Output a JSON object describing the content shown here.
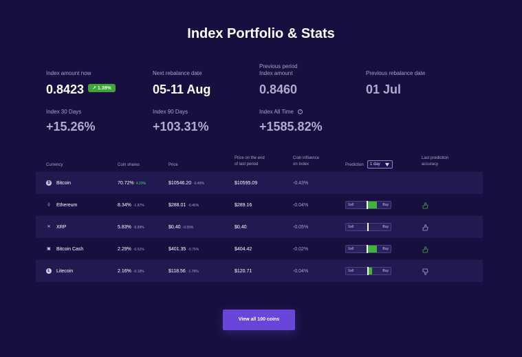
{
  "page": {
    "title": "Index Portfolio & Stats"
  },
  "stats": {
    "index_amount_now": {
      "label": "Index amount now",
      "value": "0.8423",
      "badge": "↗ 1.39%"
    },
    "next_rebalance": {
      "label": "Next rebalance date",
      "value": "05-11 Aug"
    },
    "previous_period": {
      "label_line1": "Previous period",
      "label_line2": "Index amount",
      "value": "0.8460"
    },
    "previous_rebalance": {
      "label": "Previous rebalance date",
      "value": "01 Jul"
    },
    "index_30": {
      "label": "Index 30 Days",
      "value": "+15.26%"
    },
    "index_90": {
      "label": "Index 90 Days",
      "value": "+103.31%"
    },
    "index_all": {
      "label": "Index All Time",
      "value": "+1585.82%"
    }
  },
  "table": {
    "headers": {
      "currency": "Currency",
      "coin_shares": "Coin shares",
      "price": "Price",
      "price_end_line1": "Price on the end",
      "price_end_line2": "of last period",
      "influence_line1": "Coin influence",
      "influence_line2": "on Index",
      "prediction": "Prediction",
      "prediction_select": "1 day",
      "accuracy_line1": "Last prediction",
      "accuracy_line2": "accuracy"
    },
    "rows": [
      {
        "name": "Bitcoin",
        "share": "70.72%",
        "share_change": "4.20%",
        "price": "$10546.20",
        "price_change": "-0.46%",
        "price_end": "$10595.09",
        "influence": "-0.43%",
        "has_prediction": false
      },
      {
        "name": "Ethereum",
        "share": "8.34%",
        "share_change": "-1.87%",
        "price": "$288.01",
        "price_change": "-0.46%",
        "price_end": "$289.16",
        "influence": "-0.04%",
        "has_prediction": true,
        "sell_label": "Sell",
        "buy_label": "Buy",
        "prediction_level": 0.5,
        "accuracy": "thumbs-up"
      },
      {
        "name": "XRP",
        "share": "5.83%",
        "share_change": "-5.89%",
        "price": "$0.40",
        "price_change": "-0.55%",
        "price_end": "$0.40",
        "influence": "-0.05%",
        "has_prediction": true,
        "sell_label": "Sell",
        "buy_label": "Buy",
        "prediction_level": 0.5,
        "accuracy": "thumbs-up"
      },
      {
        "name": "Bitcoin Cash",
        "share": "2.29%",
        "share_change": "-0.51%",
        "price": "$401.35",
        "price_change": "-0.75%",
        "price_end": "$404.42",
        "influence": "-0.02%",
        "has_prediction": true,
        "sell_label": "Sell",
        "buy_label": "Buy",
        "prediction_level": 0.5,
        "accuracy": "thumbs-up"
      },
      {
        "name": "Litecoin",
        "share": "2.16%",
        "share_change": "-0.19%",
        "price": "$118.56",
        "price_change": "-1.78%",
        "price_end": "$120.71",
        "influence": "-0.04%",
        "has_prediction": true,
        "sell_label": "Sell",
        "buy_label": "Buy",
        "prediction_level": 0.5,
        "accuracy": "thumbs-down"
      }
    ]
  },
  "footer": {
    "view_all_label": "View all 100 coins"
  },
  "colors": {
    "background": "#170f3f",
    "row_shade": "#211950",
    "accent_green": "#3fb535",
    "button": "#6a45d9"
  }
}
